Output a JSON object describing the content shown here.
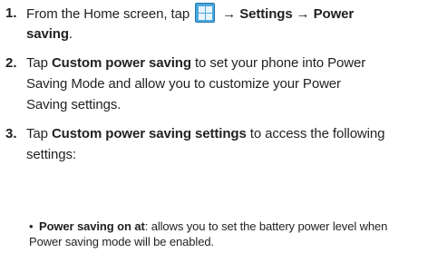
{
  "steps": [
    {
      "number": "1.",
      "line1_pre": "From the Home screen, tap",
      "line1_post_a": "→ Settings → Power",
      "line2": "saving",
      "line2_end": ".",
      "icon": "apps-grid-icon"
    },
    {
      "number": "2.",
      "line1_pre": "Tap ",
      "line1_bold": "Custom power saving",
      "line1_post": " to set your phone into Power",
      "line2": "Saving Mode and allow you to customize your Power",
      "line3": "Saving settings."
    },
    {
      "number": "3.",
      "line1_pre": "Tap ",
      "line1_bold": "Custom power saving settings",
      "line1_post": " to access the following",
      "line2": "settings:"
    }
  ],
  "bullet": {
    "mark": "•",
    "bold": "Power saving on at",
    "text": ": allows you to set the battery power level when",
    "line2": "Power saving mode will be enabled."
  },
  "colors": {
    "text": "#231f20",
    "icon_fill": "#4aa8dc"
  }
}
